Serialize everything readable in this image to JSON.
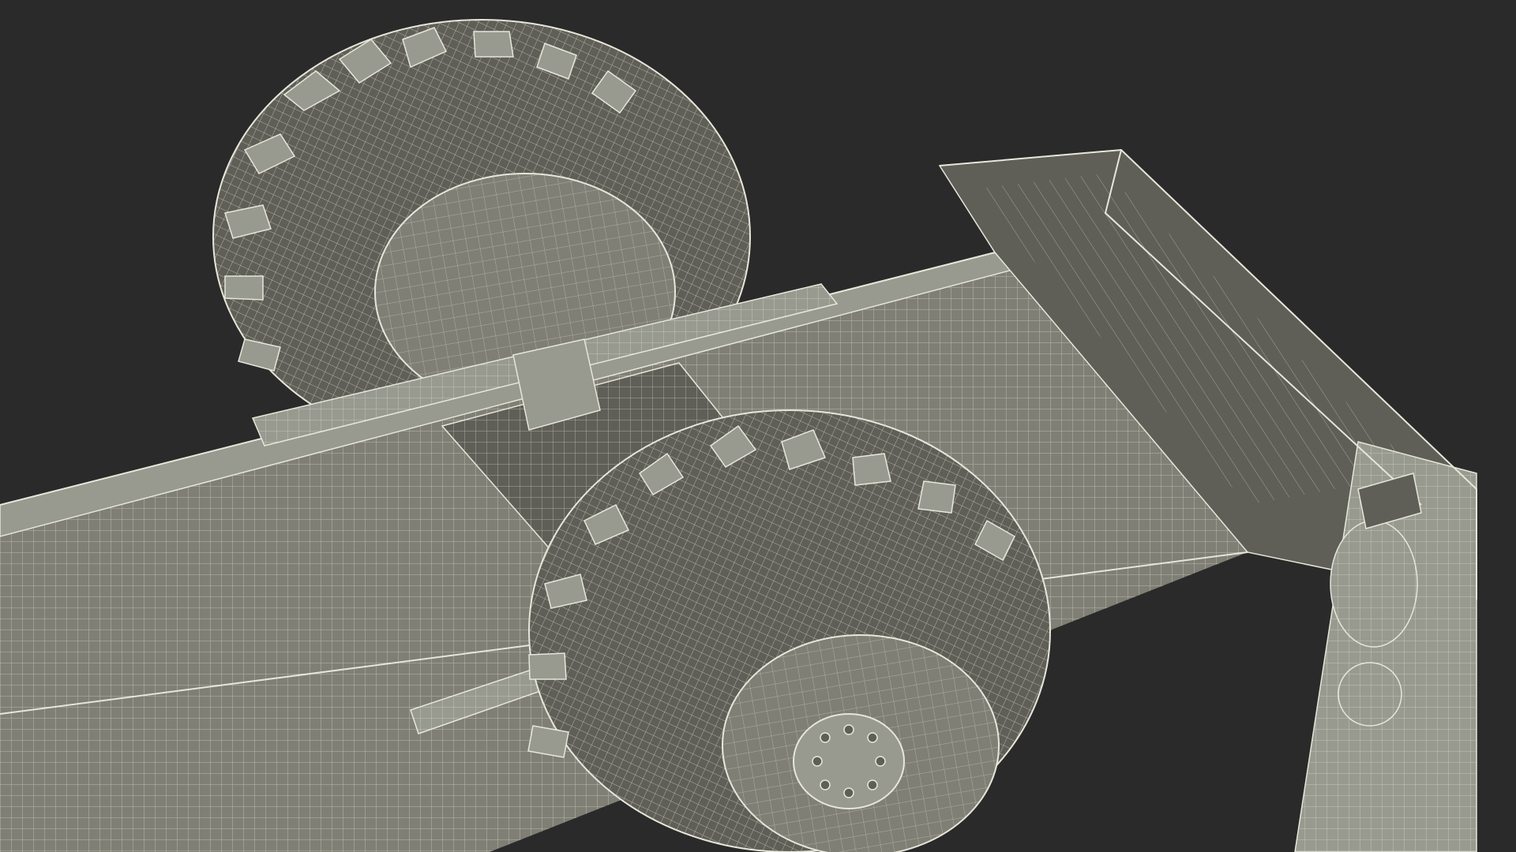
{
  "scene": {
    "subject": "trailer-underside-wireframe-render",
    "colors": {
      "background": "#2a2a2a",
      "surface": "#7f7f75",
      "surface_dark": "#5f5f57",
      "surface_light": "#999a8f",
      "wire": "#e6e6da"
    }
  }
}
